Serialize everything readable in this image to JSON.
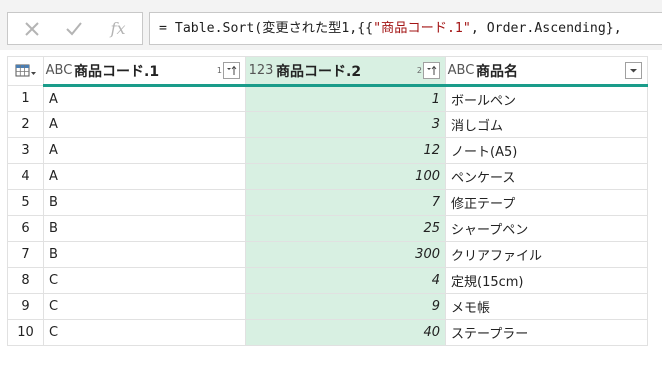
{
  "formula_bar": {
    "cancel_icon": "x-icon",
    "confirm_icon": "check-icon",
    "fx_label": "fx",
    "formula_prefix": "= Table.Sort(変更された型1,{{",
    "formula_string": "\"商品コード.1\"",
    "formula_suffix": ", Order.Ascending},"
  },
  "columns": [
    {
      "type_label": "ABC",
      "name": "商品コード.1",
      "sort_index": "1",
      "sort_icon": "sort-asc-icon"
    },
    {
      "type_label": "123",
      "name": "商品コード.2",
      "sort_index": "2",
      "sort_icon": "sort-asc-icon"
    },
    {
      "type_label": "ABC",
      "name": "商品名",
      "sort_index": "",
      "sort_icon": "dropdown-icon"
    }
  ],
  "rows": [
    {
      "n": "1",
      "c1": "A",
      "c2": "1",
      "c3": "ボールペン"
    },
    {
      "n": "2",
      "c1": "A",
      "c2": "3",
      "c3": "消しゴム"
    },
    {
      "n": "3",
      "c1": "A",
      "c2": "12",
      "c3": "ノート(A5)"
    },
    {
      "n": "4",
      "c1": "A",
      "c2": "100",
      "c3": "ペンケース"
    },
    {
      "n": "5",
      "c1": "B",
      "c2": "7",
      "c3": "修正テープ"
    },
    {
      "n": "6",
      "c1": "B",
      "c2": "25",
      "c3": "シャープペン"
    },
    {
      "n": "7",
      "c1": "B",
      "c2": "300",
      "c3": "クリアファイル"
    },
    {
      "n": "8",
      "c1": "C",
      "c2": "4",
      "c3": "定規(15cm)"
    },
    {
      "n": "9",
      "c1": "C",
      "c2": "9",
      "c3": "メモ帳"
    },
    {
      "n": "10",
      "c1": "C",
      "c2": "40",
      "c3": "ステープラー"
    }
  ],
  "colors": {
    "accent": "#1a9c8a",
    "selected_column": "#d8f0e2"
  }
}
